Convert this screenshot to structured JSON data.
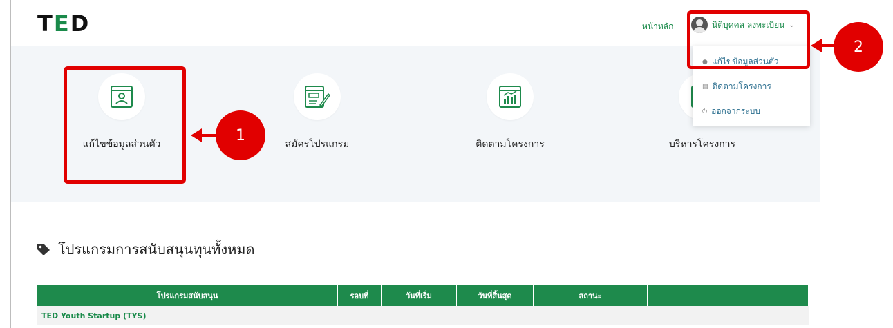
{
  "header": {
    "logo_text_left": "T",
    "logo_text_mid": "E",
    "logo_text_right": "D",
    "home_label": "หน้าหลัก",
    "user_label": "นิติบุคคล ลงทะเบียน"
  },
  "dropdown": {
    "items": [
      {
        "label": "แก้ไขข้อมูลส่วนตัว",
        "icon": "person-icon"
      },
      {
        "label": "ติดตามโครงการ",
        "icon": "list-icon"
      },
      {
        "label": "ออกจากระบบ",
        "icon": "power-icon"
      }
    ]
  },
  "tiles": [
    {
      "label": "แก้ไขข้อมูลส่วนตัว",
      "icon": "profile-card-icon"
    },
    {
      "label": "สมัครโปรแกรม",
      "icon": "form-edit-icon"
    },
    {
      "label": "ติดตามโครงการ",
      "icon": "chart-window-icon"
    },
    {
      "label": "บริหารโครงการ",
      "icon": "manage-icon"
    }
  ],
  "section": {
    "title": "โปรแกรมการสนับสนุนทุนทั้งหมด",
    "icon": "tag-icon"
  },
  "table": {
    "headers": [
      "โปรแกรมสนับสนุน",
      "รอบที่",
      "วันที่เริ่ม",
      "วันที่สิ้นสุด",
      "สถานะ",
      ""
    ],
    "rows": [
      [
        "TED Youth Startup (TYS)"
      ]
    ]
  },
  "annotations": {
    "callout_1": "1",
    "callout_2": "2",
    "color": "#e10000"
  },
  "colors": {
    "brand_green": "#1e8a4c",
    "hero_bg": "#f3f6f9"
  }
}
